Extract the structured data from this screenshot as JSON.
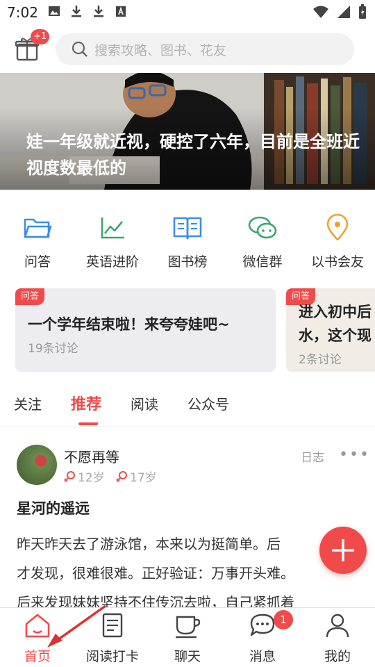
{
  "status_bar": {
    "time": "7:02"
  },
  "header": {
    "gift_badge": "+1",
    "search_placeholder": "搜索攻略、图书、花友"
  },
  "banner": {
    "title": "娃一年级就近视，硬控了六年，目前是全班近视度数最低的"
  },
  "quick_menu": [
    {
      "label": "问答",
      "icon": "folder-icon",
      "color": "#3a8ee6"
    },
    {
      "label": "英语进阶",
      "icon": "chart-line-icon",
      "color": "#3aa66a"
    },
    {
      "label": "图书榜",
      "icon": "book-icon",
      "color": "#3a8ee6"
    },
    {
      "label": "微信群",
      "icon": "chat-bubbles-icon",
      "color": "#3aa66a"
    },
    {
      "label": "以书会友",
      "icon": "location-pin-icon",
      "color": "#f0a030"
    }
  ],
  "cards": [
    {
      "tag": "问答",
      "title": "一个学年结束啦！来夸夸娃吧~",
      "count": "19条讨论"
    },
    {
      "tag": "问答",
      "title_line1": "进入初中后",
      "title_line2": "水，这个现",
      "count": "2条讨论"
    }
  ],
  "tabs": [
    {
      "label": "关注"
    },
    {
      "label": "推荐"
    },
    {
      "label": "阅读"
    },
    {
      "label": "公众号"
    }
  ],
  "post": {
    "username": "不愿再等",
    "ages": [
      "12岁",
      "17岁"
    ],
    "type": "日志",
    "more": "•••",
    "title": "星河的遥远",
    "body_lines": [
      "昨天昨天去了游泳馆，本来以为挺简单。后",
      "才发现，很难很难。正好验证：万事开头难。",
      "后来发现妹妹坚持不住传沉去啦，自己紧抓着"
    ]
  },
  "bottom_nav": [
    {
      "label": "首页",
      "icon": "home-icon"
    },
    {
      "label": "阅读打卡",
      "icon": "notebook-icon"
    },
    {
      "label": "聊天",
      "icon": "coffee-cup-icon"
    },
    {
      "label": "消息",
      "icon": "message-icon",
      "badge": "1"
    },
    {
      "label": "我的",
      "icon": "person-icon"
    }
  ],
  "colors": {
    "accent": "#f04a4a",
    "blue": "#3a8ee6",
    "green": "#3aa66a",
    "orange": "#f0a030"
  }
}
